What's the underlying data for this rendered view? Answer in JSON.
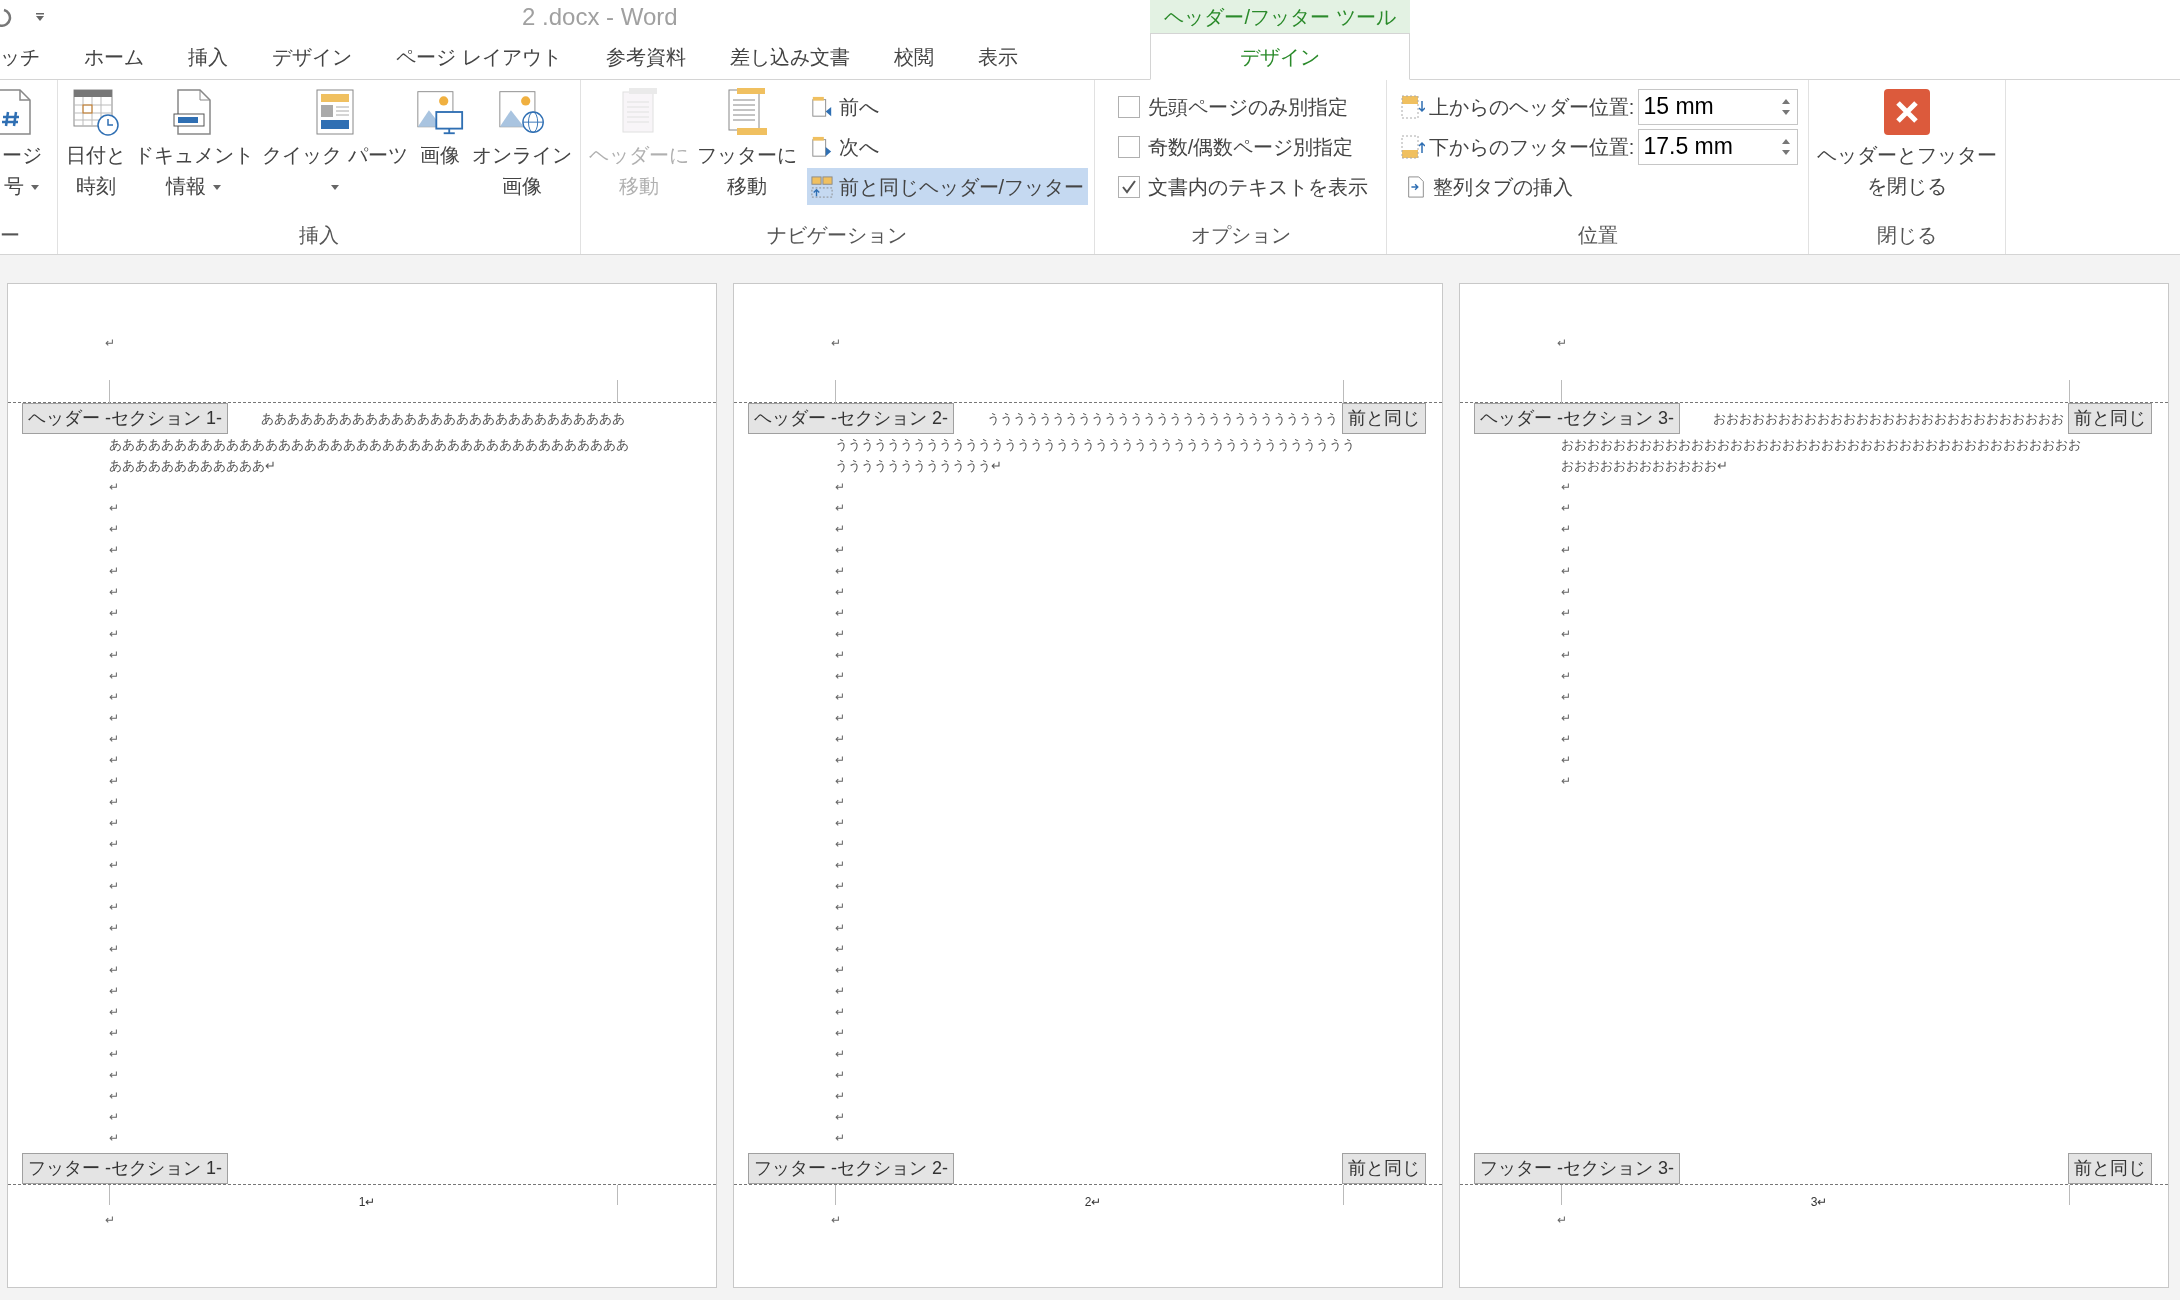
{
  "window": {
    "title": "2 .docx - Word"
  },
  "contextual_tab_group": {
    "label": "ヘッダー/フッター ツール"
  },
  "tabs": [
    {
      "label": "ッチ",
      "selected": false
    },
    {
      "label": "ホーム",
      "selected": false
    },
    {
      "label": "挿入",
      "selected": false
    },
    {
      "label": "デザイン",
      "selected": false
    },
    {
      "label": "ページ レイアウト",
      "selected": false
    },
    {
      "label": "参考資料",
      "selected": false
    },
    {
      "label": "差し込み文書",
      "selected": false
    },
    {
      "label": "校閲",
      "selected": false
    },
    {
      "label": "表示",
      "selected": false
    },
    {
      "label": "デザイン",
      "selected": true
    }
  ],
  "ribbon": {
    "groups": [
      {
        "label": "ー",
        "items": [
          {
            "kind": "large",
            "lines": [
              "ージ",
              "号"
            ],
            "dropdown": true,
            "disabled": false
          }
        ]
      },
      {
        "label": "挿入",
        "items": [
          {
            "kind": "large",
            "lines": [
              "日付と",
              "時刻"
            ],
            "dropdown": false,
            "disabled": false
          },
          {
            "kind": "large",
            "lines": [
              "ドキュメント",
              "情報"
            ],
            "dropdown": true,
            "disabled": false
          },
          {
            "kind": "large",
            "lines": [
              "クイック パーツ"
            ],
            "dropdown": true,
            "disabled": false
          },
          {
            "kind": "large",
            "lines": [
              "画像"
            ],
            "dropdown": false,
            "disabled": false
          },
          {
            "kind": "large",
            "lines": [
              "オンライン",
              "画像"
            ],
            "dropdown": false,
            "disabled": false
          }
        ]
      },
      {
        "label": "ナビゲーション",
        "items": [
          {
            "kind": "large",
            "lines": [
              "ヘッダーに",
              "移動"
            ],
            "dropdown": false,
            "disabled": true
          },
          {
            "kind": "large",
            "lines": [
              "フッターに",
              "移動"
            ],
            "dropdown": false,
            "disabled": false
          },
          {
            "kind": "small",
            "label": "前へ",
            "on": false
          },
          {
            "kind": "small",
            "label": "次へ",
            "on": false
          },
          {
            "kind": "small",
            "label": "前と同じヘッダー/フッター",
            "on": true
          }
        ]
      },
      {
        "label": "オプション",
        "items": [
          {
            "kind": "checkbox",
            "label": "先頭ページのみ別指定",
            "checked": false
          },
          {
            "kind": "checkbox",
            "label": "奇数/偶数ページ別指定",
            "checked": false
          },
          {
            "kind": "checkbox",
            "label": "文書内のテキストを表示",
            "checked": true
          }
        ]
      },
      {
        "label": "位置",
        "items": [
          {
            "kind": "spin",
            "label": "上からのヘッダー位置:",
            "value": "15 mm"
          },
          {
            "kind": "spin",
            "label": "下からのフッター位置:",
            "value": "17.5 mm"
          },
          {
            "kind": "small",
            "label": "整列タブの挿入",
            "on": false
          }
        ]
      },
      {
        "label": "閉じる",
        "items": [
          {
            "kind": "large",
            "lines": [
              "ヘッダーとフッター",
              "を閉じる"
            ],
            "dropdown": false,
            "disabled": false
          }
        ]
      }
    ]
  },
  "pages": [
    {
      "header_mark": "↵",
      "header_tag": "ヘッダー -セクション 1-",
      "body_lines": [
        "ああああああああああああああああああああああああああああ",
        "ああああああああああああああああああああああああああああああああああああああああ",
        "ああああああああああああ↵"
      ],
      "paragraph_marks": [
        "↵",
        "↵",
        "↵",
        "↵",
        "↵",
        "↵",
        "↵",
        "↵",
        "↵",
        "↵",
        "↵",
        "↵",
        "↵",
        "↵",
        "↵",
        "↵",
        "↵",
        "↵",
        "↵",
        "↵",
        "↵",
        "↵",
        "↵",
        "↵",
        "↵",
        "↵",
        "↵",
        "↵",
        "↵",
        "↵",
        "↵",
        "↵"
      ],
      "footer_tag": "フッター -セクション 1-",
      "page_number": "1↵",
      "footer_mark": "↵"
    },
    {
      "header_mark": "↵",
      "header_tag": "ヘッダー -セクション 2-",
      "header_link_tag": "前と同じ",
      "body_lines": [
        "ううううううううううううううううううううううううううう",
        "うううううううううううううううううううううううううううううううううううううううう",
        "うううううううううううう↵"
      ],
      "paragraph_marks": [
        "↵",
        "↵",
        "↵",
        "↵",
        "↵",
        "↵",
        "↵",
        "↵",
        "↵",
        "↵",
        "↵",
        "↵",
        "↵",
        "↵",
        "↵",
        "↵",
        "↵",
        "↵",
        "↵",
        "↵",
        "↵",
        "↵",
        "↵",
        "↵",
        "↵",
        "↵",
        "↵",
        "↵",
        "↵",
        "↵",
        "↵",
        "↵"
      ],
      "footer_tag": "フッター -セクション 2-",
      "footer_link_tag": "前と同じ",
      "page_number": "2↵",
      "footer_mark": "↵"
    },
    {
      "header_mark": "↵",
      "header_tag": "ヘッダー -セクション 3-",
      "header_link_tag": "前と同じ",
      "body_lines": [
        "おおおおおおおおおおおおおおおおおおおおおおおおおおお",
        "おおおおおおおおおおおおおおおおおおおおおおおおおおおおおおおおおおおおおおおお",
        "おおおおおおおおおおおお↵"
      ],
      "paragraph_marks": [
        "↵",
        "↵",
        "↵",
        "↵",
        "↵",
        "↵",
        "↵",
        "↵",
        "↵",
        "↵",
        "↵",
        "↵",
        "↵",
        "↵",
        "↵"
      ],
      "footer_tag": "フッター -セクション 3-",
      "footer_link_tag": "前と同じ",
      "page_number": "3↵",
      "footer_mark": "↵"
    }
  ]
}
